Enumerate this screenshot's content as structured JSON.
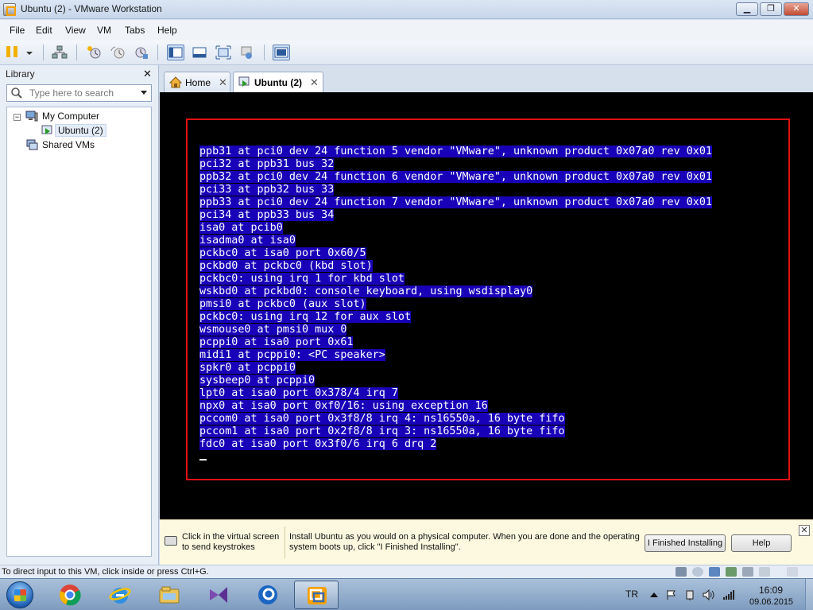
{
  "window": {
    "title": "Ubuntu (2) - VMware Workstation",
    "min_label": "▁",
    "max_label": "❐",
    "close_label": "✕"
  },
  "menu": [
    "File",
    "Edit",
    "View",
    "VM",
    "Tabs",
    "Help"
  ],
  "library": {
    "title": "Library",
    "close_label": "✕",
    "search_placeholder": "Type here to search",
    "tree": {
      "toggle": "−",
      "my_computer": "My Computer",
      "ubuntu": "Ubuntu (2)",
      "shared": "Shared VMs"
    }
  },
  "tabs": [
    {
      "label": "Home",
      "close": "✕"
    },
    {
      "label": "Ubuntu (2)",
      "close": "✕"
    }
  ],
  "console": {
    "lines": [
      "ppb31 at pci0 dev 24 function 5 vendor \"VMware\", unknown product 0x07a0 rev 0x01",
      "pci32 at ppb31 bus 32",
      "ppb32 at pci0 dev 24 function 6 vendor \"VMware\", unknown product 0x07a0 rev 0x01",
      "pci33 at ppb32 bus 33",
      "ppb33 at pci0 dev 24 function 7 vendor \"VMware\", unknown product 0x07a0 rev 0x01",
      "pci34 at ppb33 bus 34",
      "isa0 at pcib0",
      "isadma0 at isa0",
      "pckbc0 at isa0 port 0x60/5",
      "pckbd0 at pckbc0 (kbd slot)",
      "pckbc0: using irq 1 for kbd slot",
      "wskbd0 at pckbd0: console keyboard, using wsdisplay0",
      "pmsi0 at pckbc0 (aux slot)",
      "pckbc0: using irq 12 for aux slot",
      "wsmouse0 at pmsi0 mux 0",
      "pcppi0 at isa0 port 0x61",
      "midi1 at pcppi0: <PC speaker>",
      "spkr0 at pcppi0",
      "sysbeep0 at pcppi0",
      "lpt0 at isa0 port 0x378/4 irq 7",
      "npx0 at isa0 port 0xf0/16: using exception 16",
      "pccom0 at isa0 port 0x3f8/8 irq 4: ns16550a, 16 byte fifo",
      "pccom1 at isa0 port 0x2f8/8 irq 3: ns16550a, 16 byte fifo",
      "fdc0 at isa0 port 0x3f0/6 irq 6 drq 2"
    ],
    "highlight_color": "#1800b8",
    "frame_color": "#e11111"
  },
  "hint": {
    "click_text": "Click in the virtual screen to send keystrokes",
    "install_text": "Install Ubuntu as you would on a physical computer. When you are done and the operating system boots up, click \"I Finished Installing\".",
    "finished_button": "I Finished Installing",
    "help_button": "Help",
    "close_label": "✕"
  },
  "status": {
    "text": "To direct input to this VM, click inside or press Ctrl+G."
  },
  "taskbar": {
    "apps": [
      "chrome-icon",
      "ie-icon",
      "explorer-icon",
      "visual-studio-icon",
      "vmware-icon-2",
      "vmware-workstation-icon"
    ],
    "lang": "TR",
    "time": "16:09",
    "date": "09.06.2015"
  }
}
